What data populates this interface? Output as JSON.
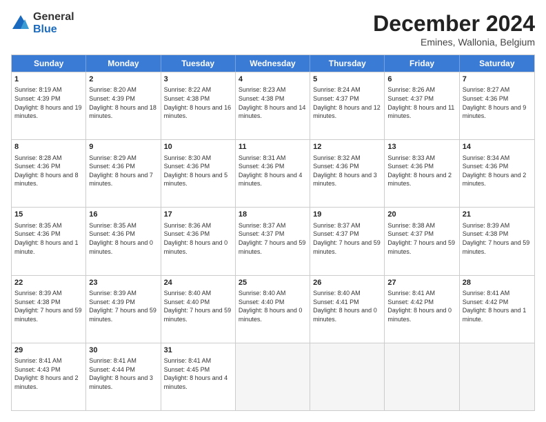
{
  "logo": {
    "general": "General",
    "blue": "Blue"
  },
  "header": {
    "month": "December 2024",
    "location": "Emines, Wallonia, Belgium"
  },
  "days": [
    "Sunday",
    "Monday",
    "Tuesday",
    "Wednesday",
    "Thursday",
    "Friday",
    "Saturday"
  ],
  "weeks": [
    [
      {
        "day": "1",
        "sunrise": "8:19 AM",
        "sunset": "4:39 PM",
        "daylight": "8 hours and 19 minutes."
      },
      {
        "day": "2",
        "sunrise": "8:20 AM",
        "sunset": "4:39 PM",
        "daylight": "8 hours and 18 minutes."
      },
      {
        "day": "3",
        "sunrise": "8:22 AM",
        "sunset": "4:38 PM",
        "daylight": "8 hours and 16 minutes."
      },
      {
        "day": "4",
        "sunrise": "8:23 AM",
        "sunset": "4:38 PM",
        "daylight": "8 hours and 14 minutes."
      },
      {
        "day": "5",
        "sunrise": "8:24 AM",
        "sunset": "4:37 PM",
        "daylight": "8 hours and 12 minutes."
      },
      {
        "day": "6",
        "sunrise": "8:26 AM",
        "sunset": "4:37 PM",
        "daylight": "8 hours and 11 minutes."
      },
      {
        "day": "7",
        "sunrise": "8:27 AM",
        "sunset": "4:36 PM",
        "daylight": "8 hours and 9 minutes."
      }
    ],
    [
      {
        "day": "8",
        "sunrise": "8:28 AM",
        "sunset": "4:36 PM",
        "daylight": "8 hours and 8 minutes."
      },
      {
        "day": "9",
        "sunrise": "8:29 AM",
        "sunset": "4:36 PM",
        "daylight": "8 hours and 7 minutes."
      },
      {
        "day": "10",
        "sunrise": "8:30 AM",
        "sunset": "4:36 PM",
        "daylight": "8 hours and 5 minutes."
      },
      {
        "day": "11",
        "sunrise": "8:31 AM",
        "sunset": "4:36 PM",
        "daylight": "8 hours and 4 minutes."
      },
      {
        "day": "12",
        "sunrise": "8:32 AM",
        "sunset": "4:36 PM",
        "daylight": "8 hours and 3 minutes."
      },
      {
        "day": "13",
        "sunrise": "8:33 AM",
        "sunset": "4:36 PM",
        "daylight": "8 hours and 2 minutes."
      },
      {
        "day": "14",
        "sunrise": "8:34 AM",
        "sunset": "4:36 PM",
        "daylight": "8 hours and 2 minutes."
      }
    ],
    [
      {
        "day": "15",
        "sunrise": "8:35 AM",
        "sunset": "4:36 PM",
        "daylight": "8 hours and 1 minute."
      },
      {
        "day": "16",
        "sunrise": "8:35 AM",
        "sunset": "4:36 PM",
        "daylight": "8 hours and 0 minutes."
      },
      {
        "day": "17",
        "sunrise": "8:36 AM",
        "sunset": "4:36 PM",
        "daylight": "8 hours and 0 minutes."
      },
      {
        "day": "18",
        "sunrise": "8:37 AM",
        "sunset": "4:37 PM",
        "daylight": "7 hours and 59 minutes."
      },
      {
        "day": "19",
        "sunrise": "8:37 AM",
        "sunset": "4:37 PM",
        "daylight": "7 hours and 59 minutes."
      },
      {
        "day": "20",
        "sunrise": "8:38 AM",
        "sunset": "4:37 PM",
        "daylight": "7 hours and 59 minutes."
      },
      {
        "day": "21",
        "sunrise": "8:39 AM",
        "sunset": "4:38 PM",
        "daylight": "7 hours and 59 minutes."
      }
    ],
    [
      {
        "day": "22",
        "sunrise": "8:39 AM",
        "sunset": "4:38 PM",
        "daylight": "7 hours and 59 minutes."
      },
      {
        "day": "23",
        "sunrise": "8:39 AM",
        "sunset": "4:39 PM",
        "daylight": "7 hours and 59 minutes."
      },
      {
        "day": "24",
        "sunrise": "8:40 AM",
        "sunset": "4:40 PM",
        "daylight": "7 hours and 59 minutes."
      },
      {
        "day": "25",
        "sunrise": "8:40 AM",
        "sunset": "4:40 PM",
        "daylight": "8 hours and 0 minutes."
      },
      {
        "day": "26",
        "sunrise": "8:40 AM",
        "sunset": "4:41 PM",
        "daylight": "8 hours and 0 minutes."
      },
      {
        "day": "27",
        "sunrise": "8:41 AM",
        "sunset": "4:42 PM",
        "daylight": "8 hours and 0 minutes."
      },
      {
        "day": "28",
        "sunrise": "8:41 AM",
        "sunset": "4:42 PM",
        "daylight": "8 hours and 1 minute."
      }
    ],
    [
      {
        "day": "29",
        "sunrise": "8:41 AM",
        "sunset": "4:43 PM",
        "daylight": "8 hours and 2 minutes."
      },
      {
        "day": "30",
        "sunrise": "8:41 AM",
        "sunset": "4:44 PM",
        "daylight": "8 hours and 3 minutes."
      },
      {
        "day": "31",
        "sunrise": "8:41 AM",
        "sunset": "4:45 PM",
        "daylight": "8 hours and 4 minutes."
      },
      null,
      null,
      null,
      null
    ]
  ]
}
